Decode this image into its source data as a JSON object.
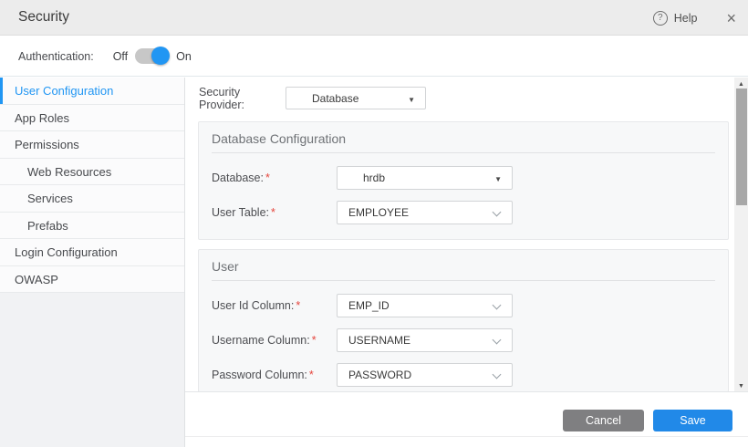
{
  "header": {
    "title": "Security",
    "help_label": "Help"
  },
  "icons": {
    "help": "?",
    "close": "×",
    "select_arrow": "▼",
    "scroll_up": "▲",
    "scroll_down": "▼"
  },
  "auth": {
    "label": "Authentication:",
    "off_label": "Off",
    "on_label": "On",
    "state": "on"
  },
  "sidebar": {
    "items": [
      {
        "label": "User Configuration",
        "active": true,
        "indent": false
      },
      {
        "label": "App Roles",
        "active": false,
        "indent": false
      },
      {
        "label": "Permissions",
        "active": false,
        "indent": false
      },
      {
        "label": "Web Resources",
        "active": false,
        "indent": true
      },
      {
        "label": "Services",
        "active": false,
        "indent": true
      },
      {
        "label": "Prefabs",
        "active": false,
        "indent": true
      },
      {
        "label": "Login Configuration",
        "active": false,
        "indent": false
      },
      {
        "label": "OWASP",
        "active": false,
        "indent": false
      }
    ]
  },
  "provider": {
    "label": "Security Provider:",
    "value": "Database"
  },
  "required_mark": "*",
  "sections": [
    {
      "title": "Database Configuration",
      "fields": [
        {
          "label": "Database:",
          "value": "hrdb",
          "required": true
        },
        {
          "label": "User Table:",
          "value": "EMPLOYEE",
          "required": true
        }
      ]
    },
    {
      "title": "User",
      "fields": [
        {
          "label": "User Id Column:",
          "value": "EMP_ID",
          "required": true
        },
        {
          "label": "Username Column:",
          "value": "USERNAME",
          "required": true
        },
        {
          "label": "Password Column:",
          "value": "PASSWORD",
          "required": true
        }
      ]
    }
  ],
  "footer": {
    "cancel_label": "Cancel",
    "save_label": "Save"
  },
  "colors": {
    "accent": "#2196f3",
    "save_button": "#2189e8",
    "cancel_button": "#7f7f81",
    "required": "#e5453d",
    "header_bg": "#ececec",
    "panel_bg": "#f7f8f9"
  }
}
